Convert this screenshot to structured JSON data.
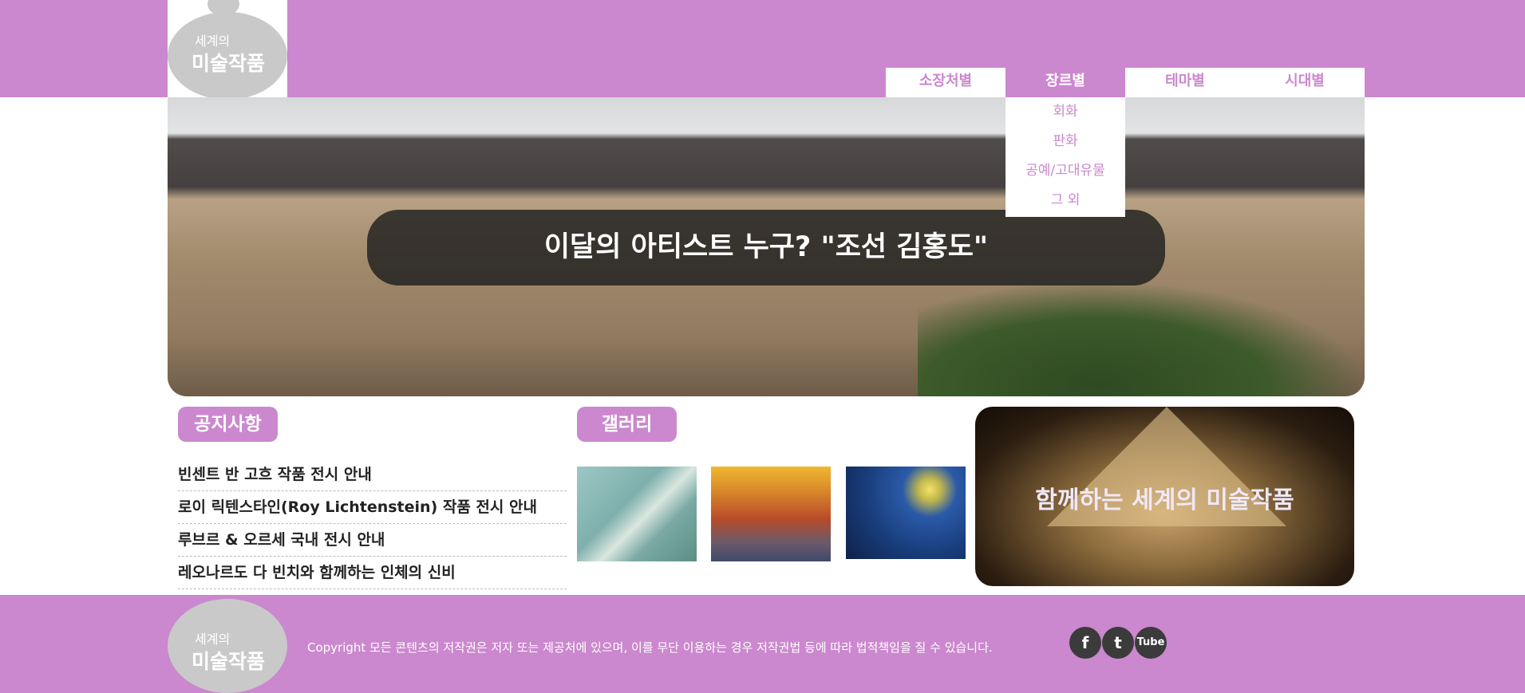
{
  "logo": {
    "line1": "세계의",
    "line2": "미술작품"
  },
  "nav": [
    {
      "label": "소장처별"
    },
    {
      "label": "장르별"
    },
    {
      "label": "테마별"
    },
    {
      "label": "시대별"
    }
  ],
  "dropdown": [
    "회화",
    "판화",
    "공예/고대유물",
    "그 외"
  ],
  "hero": {
    "banner": "이달의 아티스트 누구? \"조선 김홍도\""
  },
  "notice": {
    "title": "공지사항",
    "items": [
      "빈센트 반 고흐 작품 전시 안내",
      "로이 릭텐스타인(Roy Lichtenstein) 작품 전시 안내",
      "루브르 & 오르세 국내 전시 안내",
      "레오나르도 다 빈치와 함께하는 인체의 신비"
    ]
  },
  "gallery": {
    "title": "갤러리",
    "images": [
      "almond-blossoms",
      "red-vineyard",
      "starry-night"
    ]
  },
  "promo": {
    "title": "함께하는 세계의 미술작품"
  },
  "footer": {
    "copyright": "Copyright 모든 콘텐츠의 저작권은 저자 또는 제공처에 있으며, 이를 무단 이용하는 경우 저작권법 등에 따라 법적책임을 질 수 있습니다.",
    "social": [
      {
        "icon": "facebook-icon",
        "glyph": "f"
      },
      {
        "icon": "twitter-icon",
        "glyph": "t"
      },
      {
        "icon": "youtube-icon",
        "glyph": "Tube"
      }
    ]
  },
  "colors": {
    "brand": "#cb88ce"
  }
}
